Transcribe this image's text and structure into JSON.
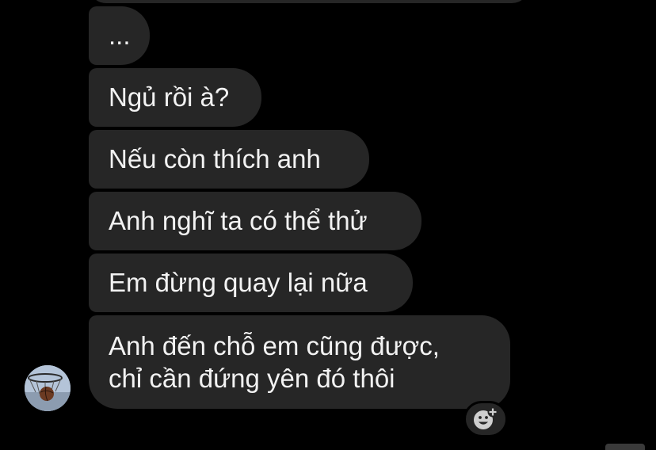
{
  "conversation": {
    "messages": [
      {
        "text": "..."
      },
      {
        "text": "Ngủ rồi à?"
      },
      {
        "text": "Nếu còn thích anh"
      },
      {
        "text": "Anh nghĩ ta có thể thử"
      },
      {
        "text": "Em đừng quay lại nữa"
      },
      {
        "lines": [
          "Anh đến chỗ em cũng được,",
          "chỉ cần đứng yên đó thôi"
        ]
      }
    ]
  },
  "colors": {
    "background": "#000000",
    "bubble": "#262626",
    "text": "#f2f2f2"
  },
  "icons": {
    "avatar": "basketball-hoop-avatar",
    "reaction": "add-reaction-icon"
  }
}
